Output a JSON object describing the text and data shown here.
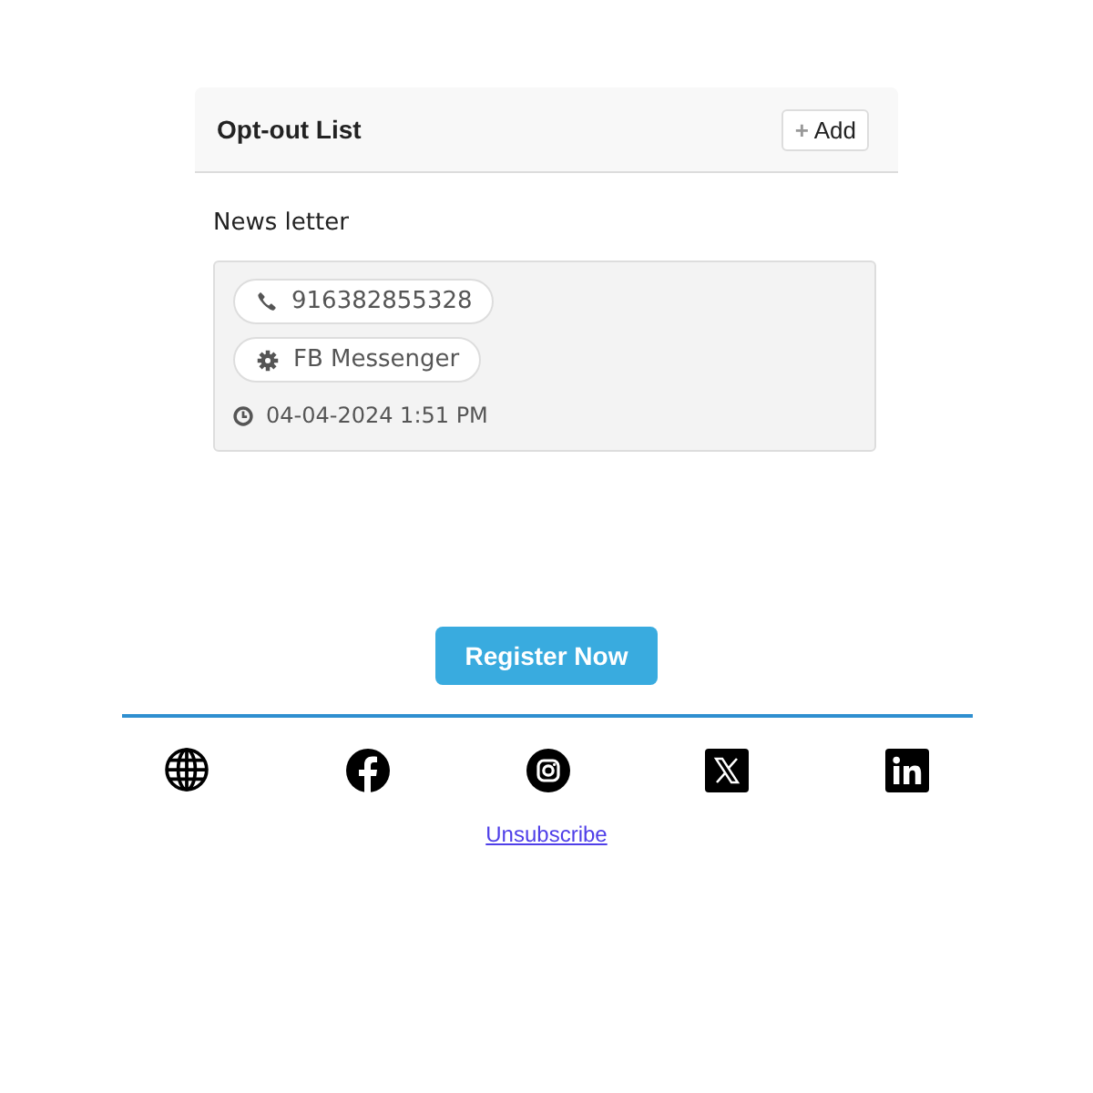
{
  "panel": {
    "title": "Opt-out List",
    "add_button": {
      "icon": "+",
      "label": "Add"
    }
  },
  "section": {
    "label": "News letter"
  },
  "entry": {
    "chips": [
      {
        "kind": "phone",
        "label": "916382855328"
      },
      {
        "kind": "gear",
        "label": "FB Messenger"
      }
    ],
    "timestamp": "04-04-2024 1:51 PM"
  },
  "cta": {
    "label": "Register Now"
  },
  "footer": {
    "unsubscribe": "Unsubscribe"
  }
}
